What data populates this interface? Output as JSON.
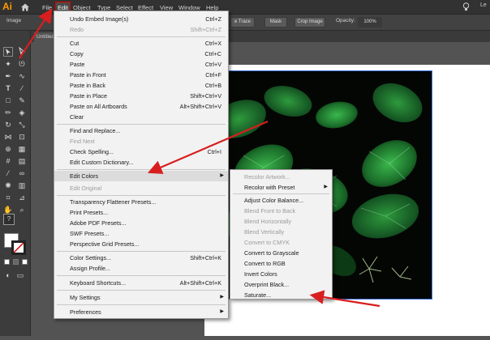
{
  "app": {
    "logo": "Ai"
  },
  "menubar": {
    "items": [
      "File",
      "Edit",
      "Object",
      "Type",
      "Select",
      "Effect",
      "View",
      "Window",
      "Help"
    ],
    "right_text": "Le"
  },
  "controlbar": {
    "left_label": "Image",
    "trace_label": "e Trace",
    "mask_label": "Mask",
    "crop_label": "Crop Image",
    "opacity_label": "Opacity:",
    "opacity_value": "100%"
  },
  "document": {
    "tab_title": "Untitled"
  },
  "edit_menu": {
    "items": [
      {
        "label": "Undo Embed Image(s)",
        "shortcut": "Ctrl+Z",
        "disabled": false
      },
      {
        "label": "Redo",
        "shortcut": "Shift+Ctrl+Z",
        "disabled": true
      },
      {
        "label": "Cut",
        "shortcut": "Ctrl+X",
        "disabled": false
      },
      {
        "label": "Copy",
        "shortcut": "Ctrl+C",
        "disabled": false
      },
      {
        "label": "Paste",
        "shortcut": "Ctrl+V",
        "disabled": false
      },
      {
        "label": "Paste in Front",
        "shortcut": "Ctrl+F",
        "disabled": false
      },
      {
        "label": "Paste in Back",
        "shortcut": "Ctrl+B",
        "disabled": false
      },
      {
        "label": "Paste in Place",
        "shortcut": "Shift+Ctrl+V",
        "disabled": false
      },
      {
        "label": "Paste on All Artboards",
        "shortcut": "Alt+Shift+Ctrl+V",
        "disabled": false
      },
      {
        "label": "Clear",
        "shortcut": "",
        "disabled": false
      },
      {
        "label": "Find and Replace...",
        "shortcut": "",
        "disabled": false
      },
      {
        "label": "Find Next",
        "shortcut": "",
        "disabled": true
      },
      {
        "label": "Check Spelling...",
        "shortcut": "Ctrl+I",
        "disabled": false
      },
      {
        "label": "Edit Custom Dictionary...",
        "shortcut": "",
        "disabled": false
      },
      {
        "label": "Edit Colors",
        "shortcut": "",
        "disabled": false,
        "submenu": true
      },
      {
        "label": "Edit Original",
        "shortcut": "",
        "disabled": true
      },
      {
        "label": "Transparency Flattener Presets...",
        "shortcut": "",
        "disabled": false
      },
      {
        "label": "Print Presets...",
        "shortcut": "",
        "disabled": false
      },
      {
        "label": "Adobe PDF Presets...",
        "shortcut": "",
        "disabled": false
      },
      {
        "label": "SWF Presets...",
        "shortcut": "",
        "disabled": false
      },
      {
        "label": "Perspective Grid Presets...",
        "shortcut": "",
        "disabled": false
      },
      {
        "label": "Color Settings...",
        "shortcut": "Shift+Ctrl+K",
        "disabled": false
      },
      {
        "label": "Assign Profile...",
        "shortcut": "",
        "disabled": false
      },
      {
        "label": "Keyboard Shortcuts...",
        "shortcut": "Alt+Shift+Ctrl+K",
        "disabled": false
      },
      {
        "label": "My Settings",
        "shortcut": "",
        "disabled": false,
        "submenu": true
      },
      {
        "label": "Preferences",
        "shortcut": "",
        "disabled": false,
        "submenu": true
      }
    ]
  },
  "edit_colors_menu": {
    "items": [
      {
        "label": "Recolor Artwork...",
        "disabled": true
      },
      {
        "label": "Recolor with Preset",
        "disabled": false,
        "submenu": true
      },
      {
        "label": "Adjust Color Balance...",
        "disabled": false
      },
      {
        "label": "Blend Front to Back",
        "disabled": true
      },
      {
        "label": "Blend Horizontally",
        "disabled": true
      },
      {
        "label": "Blend Vertically",
        "disabled": true
      },
      {
        "label": "Convert to CMYK",
        "disabled": true
      },
      {
        "label": "Convert to Grayscale",
        "disabled": false
      },
      {
        "label": "Convert to RGB",
        "disabled": false
      },
      {
        "label": "Invert Colors",
        "disabled": false
      },
      {
        "label": "Overprint Black...",
        "disabled": false
      },
      {
        "label": "Saturate...",
        "disabled": false
      }
    ]
  },
  "colors": {
    "menubar_bg": "#323232",
    "menu_bg": "#f2f2f2",
    "annotation_red": "#d81e1e",
    "highlight_border": "#e00000"
  }
}
